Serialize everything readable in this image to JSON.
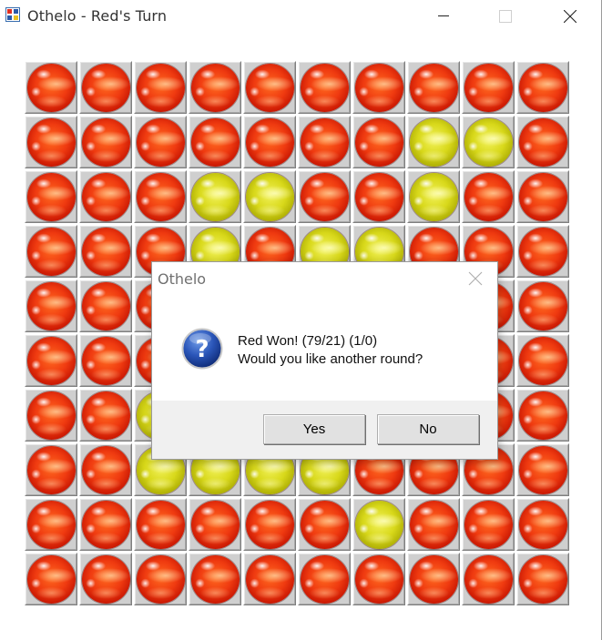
{
  "window": {
    "title": "Othelo - Red's Turn",
    "icon": "othelo-app-icon",
    "controls": [
      "minimize-icon",
      "maximize-icon",
      "close-icon"
    ]
  },
  "board": {
    "rows": 10,
    "cols": 10,
    "colors": {
      "red": "#ef3a10",
      "yellow": "#d8d81a"
    },
    "cells": [
      [
        "R",
        "R",
        "R",
        "R",
        "R",
        "R",
        "R",
        "R",
        "R",
        "R"
      ],
      [
        "R",
        "R",
        "R",
        "R",
        "R",
        "R",
        "R",
        "Y",
        "Y",
        "R"
      ],
      [
        "R",
        "R",
        "R",
        "Y",
        "Y",
        "R",
        "R",
        "Y",
        "R",
        "R"
      ],
      [
        "R",
        "R",
        "R",
        "Y",
        "R",
        "Y",
        "Y",
        "R",
        "R",
        "R"
      ],
      [
        "R",
        "R",
        "R",
        "R",
        "R",
        "R",
        "R",
        "R",
        "R",
        "R"
      ],
      [
        "R",
        "R",
        "R",
        "R",
        "R",
        "R",
        "R",
        "R",
        "R",
        "R"
      ],
      [
        "R",
        "R",
        "Y",
        "R",
        "R",
        "R",
        "R",
        "R",
        "R",
        "R"
      ],
      [
        "R",
        "R",
        "Y",
        "Y",
        "Y",
        "Y",
        "R",
        "R",
        "R",
        "R"
      ],
      [
        "R",
        "R",
        "R",
        "R",
        "R",
        "R",
        "Y",
        "R",
        "R",
        "R"
      ],
      [
        "R",
        "R",
        "R",
        "R",
        "R",
        "R",
        "R",
        "R",
        "R",
        "R"
      ]
    ]
  },
  "dialog": {
    "title": "Othelo",
    "icon": "question-icon",
    "message_line1": "Red Won! (79/21) (1/0)",
    "message_line2": "Would you like another round?",
    "yes_label": "Yes",
    "no_label": "No"
  }
}
